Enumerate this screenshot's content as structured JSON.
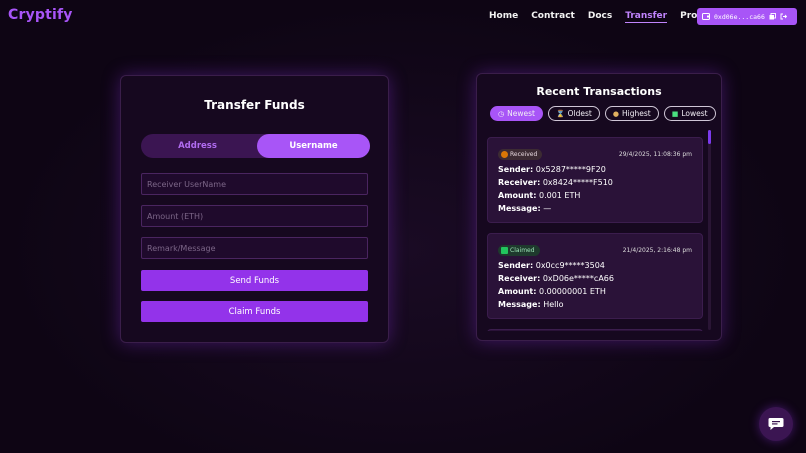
{
  "app": {
    "logo": "Cryptify"
  },
  "nav": {
    "links": [
      {
        "label": "Home",
        "active": false
      },
      {
        "label": "Contract",
        "active": false
      },
      {
        "label": "Docs",
        "active": false
      },
      {
        "label": "Transfer",
        "active": true
      },
      {
        "label": "Profile",
        "active": false
      }
    ],
    "wallet_address": "0xd06e...ca66"
  },
  "transfer": {
    "title": "Transfer Funds",
    "toggle": {
      "address_label": "Address",
      "username_label": "Username",
      "selected": "Username"
    },
    "receiver_placeholder": "Receiver UserName",
    "amount_placeholder": "Amount (ETH)",
    "message_placeholder": "Remark/Message",
    "send_label": "Send Funds",
    "claim_label": "Claim Funds"
  },
  "transactions": {
    "title": "Recent Transactions",
    "filters": [
      {
        "label": "Newest",
        "icon": "clock-icon",
        "active": true
      },
      {
        "label": "Oldest",
        "icon": "hourglass-icon",
        "active": false
      },
      {
        "label": "Highest",
        "icon": "money-bag-icon",
        "active": false
      },
      {
        "label": "Lowest",
        "icon": "banknote-icon",
        "active": false
      }
    ],
    "field_labels": {
      "sender": "Sender:",
      "receiver": "Receiver:",
      "amount": "Amount:",
      "message": "Message:"
    },
    "items": [
      {
        "status": "Received",
        "date": "29/4/2025, 11:08:36 pm",
        "sender": "0x5287*****9F20",
        "receiver": "0x8424*****F510",
        "amount": "0.001 ETH",
        "message": "—"
      },
      {
        "status": "Claimed",
        "date": "21/4/2025, 2:16:48 pm",
        "sender": "0x0cc9*****3504",
        "receiver": "0xD06e*****cA66",
        "amount": "0.00000001 ETH",
        "message": "Hello"
      }
    ]
  },
  "colors": {
    "accent": "#a855f7",
    "background": "#0e0514",
    "card": "#16081f"
  }
}
